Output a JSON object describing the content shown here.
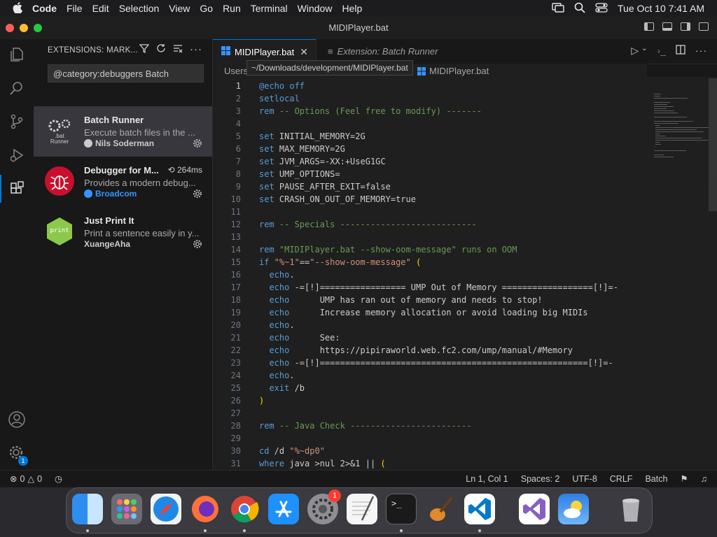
{
  "menubar": {
    "app_name": "Code",
    "items": [
      "File",
      "Edit",
      "Selection",
      "View",
      "Go",
      "Run",
      "Terminal",
      "Window",
      "Help"
    ],
    "clock": "Tue Oct 10  7:41 AM"
  },
  "window": {
    "title": "MIDIPlayer.bat"
  },
  "sidebar": {
    "title": "EXTENSIONS: MARK...",
    "search_value": "@category:debuggers Batch",
    "extensions": [
      {
        "name": "Batch Runner",
        "description": "Execute batch files in the ...",
        "publisher": "Nils Soderman",
        "icon_text": ".bat Runner",
        "verified": true
      },
      {
        "name": "Debugger for M...",
        "description": "Provides a modern debug...",
        "publisher": "Broadcom",
        "time": "264ms",
        "verified": true
      },
      {
        "name": "Just Print It",
        "description": "Print a sentence easily in y...",
        "publisher": "XuangeAha",
        "icon_text": "print",
        "verified": false
      }
    ]
  },
  "tabs": [
    {
      "label": "MIDIPlayer.bat",
      "active": true
    },
    {
      "label": "Extension: Batch Runner",
      "active": false
    }
  ],
  "breadcrumb": {
    "root": "Users",
    "file": "MIDIPlayer.bat"
  },
  "tooltip": "~/Downloads/development/MIDIPlayer.bat",
  "code_lines": [
    "@echo off",
    "setlocal",
    "rem -- Options (Feel free to modify) -------",
    "",
    "set INITIAL_MEMORY=2G",
    "set MAX_MEMORY=2G",
    "set JVM_ARGS=-XX:+UseG1GC",
    "set UMP_OPTIONS=",
    "set PAUSE_AFTER_EXIT=false",
    "set CRASH_ON_OUT_OF_MEMORY=true",
    "",
    "rem -- Specials ---------------------------",
    "",
    "rem \"MIDIPlayer.bat --show-oom-message\" runs on OOM",
    "if \"%~1\"==\"--show-oom-message\" (",
    "  echo.",
    "  echo -=[!]================= UMP Out of Memory ==================[!]=-",
    "  echo      UMP has ran out of memory and needs to stop!",
    "  echo      Increase memory allocation or avoid loading big MIDIs",
    "  echo.",
    "  echo      See:",
    "  echo      https://pipiraworld.web.fc2.com/ump/manual/#Memory",
    "  echo -=[!]=====================================================[!]=-",
    "  echo.",
    "  exit /b",
    ")",
    "",
    "rem -- Java Check ------------------------",
    "",
    "cd /d \"%~dp0\"",
    "where java >nul 2>&1 || ("
  ],
  "status": {
    "errors": "0",
    "warnings": "0",
    "position": "Ln 1, Col 1",
    "spaces": "Spaces: 2",
    "encoding": "UTF-8",
    "eol": "CRLF",
    "language": "Batch"
  },
  "badges": {
    "accounts_gear": "1",
    "dock_settings": "1"
  },
  "colors": {
    "accent": "#0078d4",
    "comment": "#6a9955",
    "keyword": "#569cd6",
    "string": "#ce9178"
  }
}
